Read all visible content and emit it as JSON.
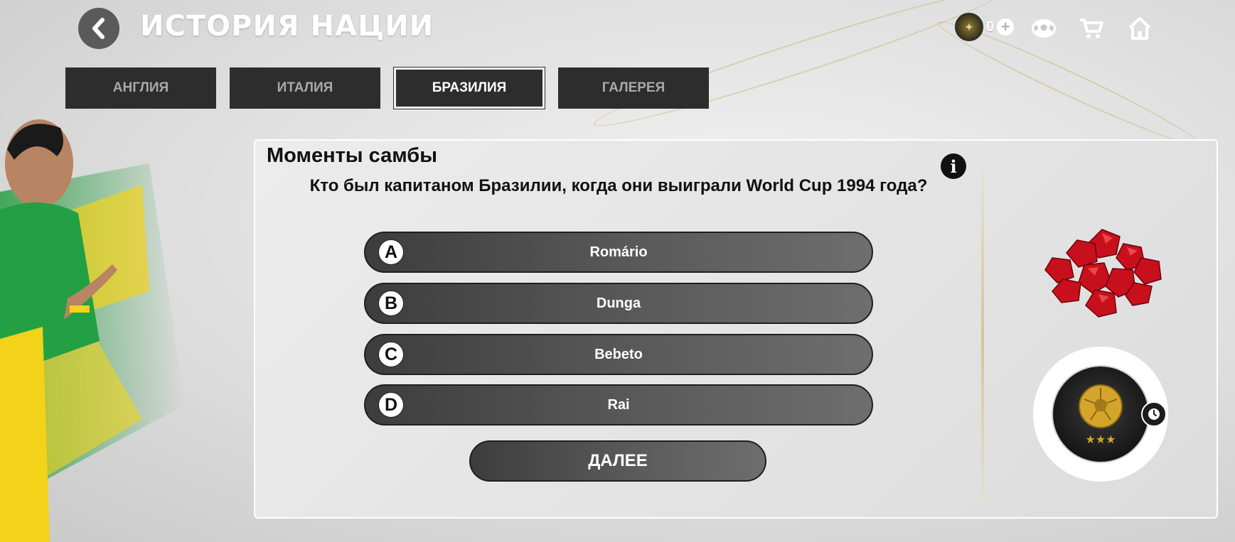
{
  "header": {
    "title": "ИСТОРИЯ НАЦИИ",
    "coins": "0"
  },
  "tabs": [
    {
      "label": "АНГЛИЯ",
      "active": false
    },
    {
      "label": "ИТАЛИЯ",
      "active": false
    },
    {
      "label": "БРАЗИЛИЯ",
      "active": true
    },
    {
      "label": "ГАЛЕРЕЯ",
      "active": false
    }
  ],
  "quiz": {
    "title": "Моменты самбы",
    "question": "Кто был капитаном Бразилии, когда они выиграли World Cup 1994 года?",
    "answers": [
      {
        "letter": "A",
        "text": "Romário"
      },
      {
        "letter": "B",
        "text": "Dunga"
      },
      {
        "letter": "C",
        "text": "Bebeto"
      },
      {
        "letter": "D",
        "text": "Rai"
      }
    ],
    "next_label": "ДАЛЕЕ"
  },
  "icons": {
    "back": "chevron-left-icon",
    "coin": "coin-icon",
    "plus": "plus-icon",
    "ball": "football-icon",
    "cart": "cart-icon",
    "home": "home-icon",
    "info": "info-icon",
    "clock": "clock-icon",
    "gems": "gems-icon",
    "reward": "golden-ball-icon"
  },
  "colors": {
    "tab_bg": "#2d2d2d",
    "button_dark": "#3d3d3d",
    "gem_red": "#c8101c",
    "gold": "#d4a52a"
  }
}
